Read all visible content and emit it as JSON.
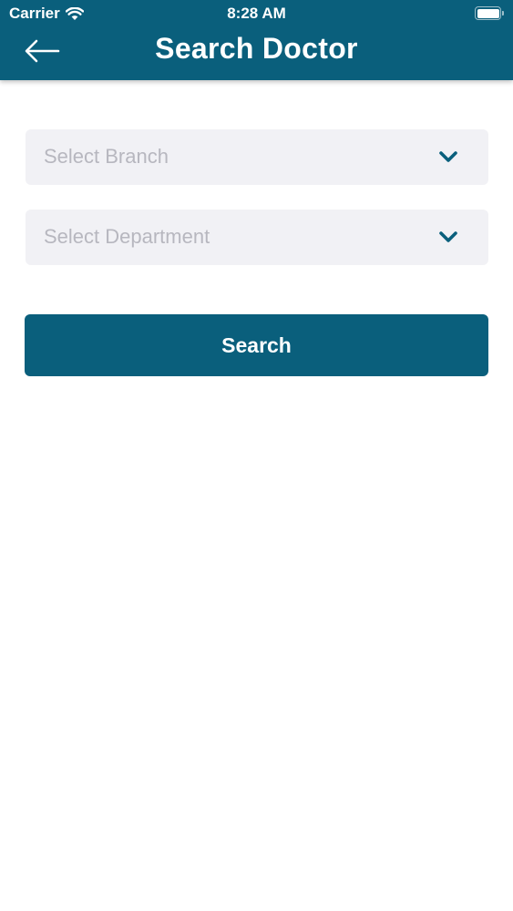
{
  "status_bar": {
    "carrier": "Carrier",
    "time": "8:28 AM",
    "wifi_icon": "wifi-icon",
    "battery_icon": "battery-icon"
  },
  "header": {
    "title": "Search Doctor",
    "back_icon": "arrow-left-icon",
    "background_color": "#0a5f7c"
  },
  "form": {
    "branch": {
      "placeholder": "Select Branch",
      "icon": "chevron-down-icon"
    },
    "department": {
      "placeholder": "Select Department",
      "icon": "chevron-down-icon"
    },
    "search_label": "Search"
  },
  "colors": {
    "accent": "#0a5f7c",
    "field_background": "#f1f1f5",
    "placeholder_text": "#b7b7bf"
  }
}
